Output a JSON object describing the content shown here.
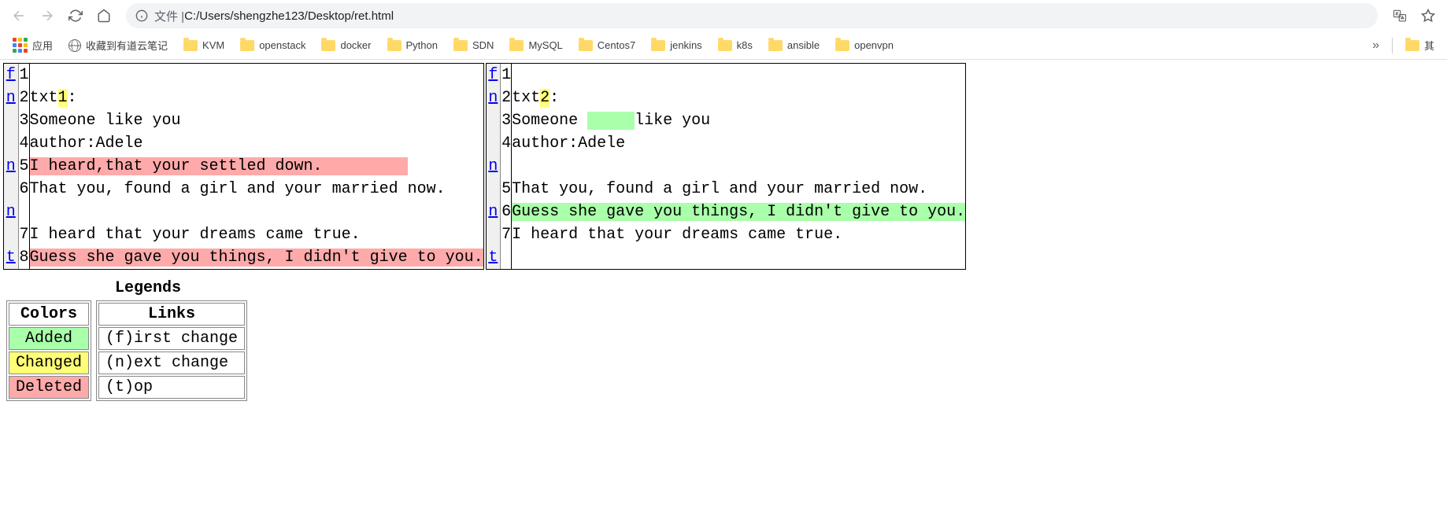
{
  "browser": {
    "url_prefix": "文件 | ",
    "url": "C:/Users/shengzhe123/Desktop/ret.html"
  },
  "bookmarks": {
    "apps": "应用",
    "youdao": "收藏到有道云笔记",
    "folders": [
      "KVM",
      "openstack",
      "docker",
      "Python",
      "SDN",
      "MySQL",
      "Centos7",
      "jenkins",
      "k8s",
      "ansible",
      "openvpn"
    ],
    "overflow": "»",
    "other": "其"
  },
  "diff": {
    "left": {
      "rows": [
        {
          "link": "f",
          "num": "1",
          "content": ""
        },
        {
          "link": "n",
          "num": "2",
          "content_pre": "txt",
          "content_hl": "1",
          "content_post": ":",
          "hl_class": "hl-changed"
        },
        {
          "link": "",
          "num": "3",
          "content": "Someone like you"
        },
        {
          "link": "",
          "num": "4",
          "content": "author:Adele"
        },
        {
          "link": "n",
          "num": "5",
          "content_full_hl": "I heard,that your settled down.         ",
          "hl_class": "hl-deleted"
        },
        {
          "link": "",
          "num": "6",
          "content": "That you, found a girl and your married now."
        },
        {
          "link": "n",
          "num": "",
          "content": ""
        },
        {
          "link": "",
          "num": "7",
          "content": "I heard that your dreams came true."
        },
        {
          "link": "t",
          "num": "8",
          "content_full_hl": "Guess she gave you things, I didn't give to you.",
          "hl_class": "hl-deleted"
        }
      ]
    },
    "right": {
      "rows": [
        {
          "link": "f",
          "num": "1",
          "content": ""
        },
        {
          "link": "n",
          "num": "2",
          "content_pre": "txt",
          "content_hl": "2",
          "content_post": ":",
          "hl_class": "hl-changed"
        },
        {
          "link": "",
          "num": "3",
          "content_pre": "Someone ",
          "content_hl": "     ",
          "content_post": "like you",
          "hl_class": "hl-added"
        },
        {
          "link": "",
          "num": "4",
          "content": "author:Adele"
        },
        {
          "link": "n",
          "num": "",
          "content": ""
        },
        {
          "link": "",
          "num": "5",
          "content": "That you, found a girl and your married now."
        },
        {
          "link": "n",
          "num": "6",
          "content_full_hl": "Guess she gave you things, I didn't give to you.",
          "hl_class": "hl-added"
        },
        {
          "link": "",
          "num": "7",
          "content": "I heard that your dreams came true."
        },
        {
          "link": "t",
          "num": "",
          "content": ""
        }
      ]
    }
  },
  "legends": {
    "title": "Legends",
    "colors_header": "Colors",
    "links_header": "Links",
    "colors": [
      {
        "label": "Added",
        "class": "legend-added"
      },
      {
        "label": "Changed",
        "class": "legend-changed"
      },
      {
        "label": "Deleted",
        "class": "legend-deleted"
      }
    ],
    "links": [
      {
        "label": "(f)irst change"
      },
      {
        "label": "(n)ext change"
      },
      {
        "label": "(t)op"
      }
    ]
  }
}
